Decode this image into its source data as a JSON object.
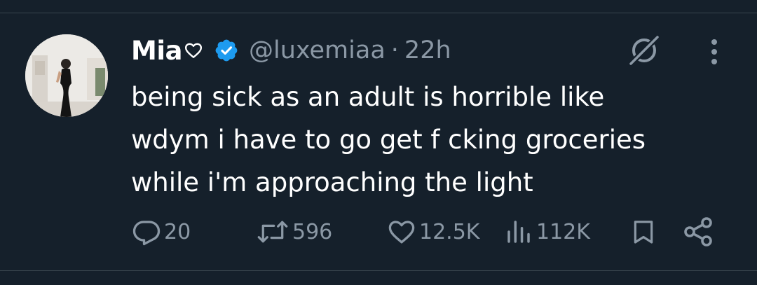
{
  "tweet": {
    "author": {
      "display_name": "Mia",
      "handle": "@luxemiaa",
      "verified": true,
      "separator": "·",
      "time": "22h"
    },
    "text_lines": [
      "being sick as an adult is horrible like",
      "wdym i have to go get f cking groceries",
      "while i'm approaching the light"
    ],
    "stats": {
      "replies": "20",
      "reposts": "596",
      "likes": "12.5K",
      "views": "112K"
    }
  },
  "icons": {
    "heart_after_name": "heart-outline-icon",
    "verified": "verified-badge-icon",
    "grok": "grok-icon",
    "more": "more-vertical-icon",
    "reply": "reply-icon",
    "repost": "repost-icon",
    "like": "like-icon",
    "views": "views-icon",
    "bookmark": "bookmark-icon",
    "share": "share-icon"
  },
  "colors": {
    "background": "#15202b",
    "text_primary": "#ffffff",
    "text_secondary": "#8b98a5",
    "verified_blue": "#1d9bf0",
    "divider": "#38444d"
  }
}
